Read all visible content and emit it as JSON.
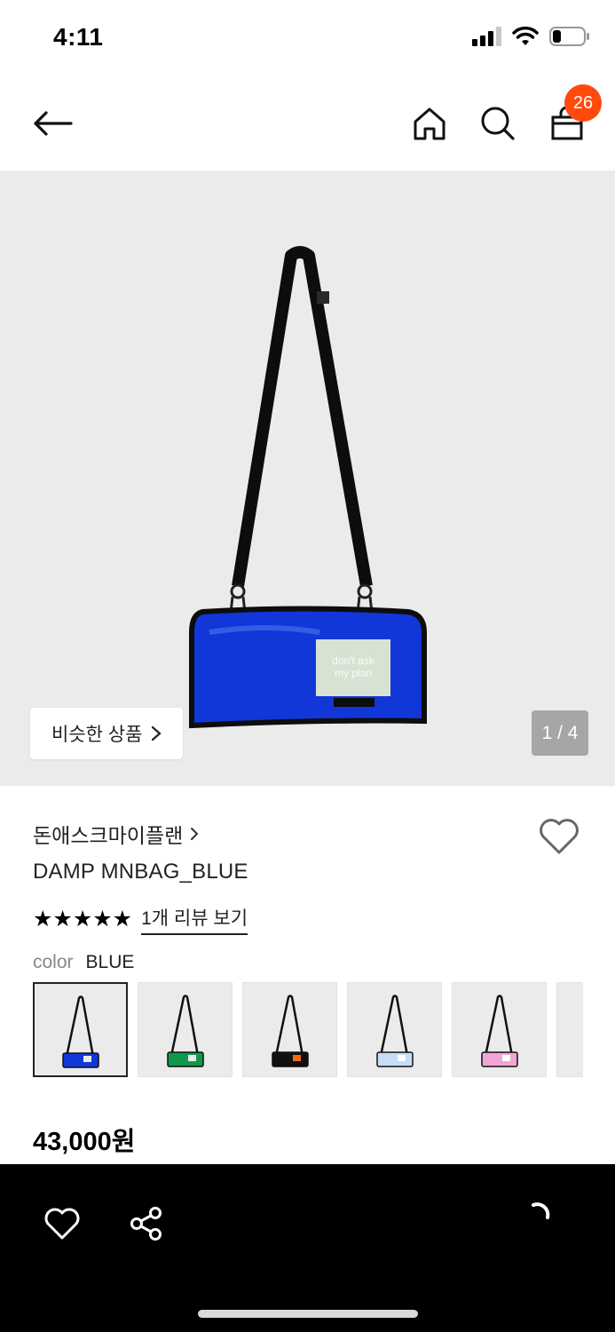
{
  "status_bar": {
    "time": "4:11",
    "icons": [
      "cellular-signal-icon",
      "wifi-icon",
      "battery-icon"
    ]
  },
  "header": {
    "icons": [
      "back-arrow-icon",
      "home-icon",
      "search-icon",
      "shopping-bag-icon"
    ],
    "cart_count": "26",
    "badge_color": "#ff4a0c"
  },
  "hero": {
    "similar_label": "비슷한 상품",
    "counter": "1 / 4",
    "product_label_text": "don't ask my plan"
  },
  "product": {
    "brand": "돈애스크마이플랜",
    "name": "DAMP MNBAG_BLUE",
    "rating": 5,
    "stars": "★★★★★",
    "review_link": "1개 리뷰 보기",
    "color_key": "color",
    "color_value": "BLUE",
    "swatches": [
      {
        "color": "BLUE",
        "hex": "#1237d8"
      },
      {
        "color": "GREEN",
        "hex": "#0f9a4a"
      },
      {
        "color": "BLACK",
        "hex": "#111111"
      },
      {
        "color": "LIGHT BLUE",
        "hex": "#c7dcf6"
      },
      {
        "color": "PINK",
        "hex": "#f2a6d6"
      }
    ],
    "price": "43,000원"
  },
  "bottom_bar": {
    "icons": [
      "heart-icon",
      "share-icon",
      "loading-spinner-icon"
    ]
  }
}
